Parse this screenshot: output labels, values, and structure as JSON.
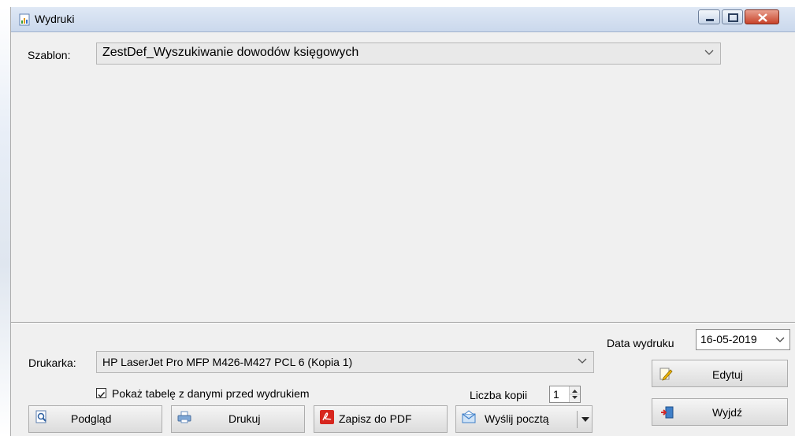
{
  "window": {
    "title": "Wydruki"
  },
  "template": {
    "label": "Szablon:",
    "value": "ZestDef_Wyszukiwanie dowodów księgowych"
  },
  "print_date": {
    "label": "Data wydruku",
    "value": "16-05-2019"
  },
  "printer": {
    "label": "Drukarka:",
    "value": "HP LaserJet Pro MFP M426-M427 PCL 6 (Kopia 1)"
  },
  "show_table": {
    "label": "Pokaż tabelę z danymi przed wydrukiem",
    "checked": true
  },
  "copies": {
    "label": "Liczba kopii",
    "value": "1"
  },
  "buttons": {
    "preview": "Podgląd",
    "print": "Drukuj",
    "save_pdf": "Zapisz do PDF",
    "send_mail": "Wyślij pocztą",
    "edit": "Edytuj",
    "exit": "Wyjdź"
  },
  "colors": {
    "window_bg": "#f0f0f0",
    "close_button": "#c8432a",
    "pdf_icon": "#d7261e"
  },
  "icons": {
    "title": "report-icon",
    "preview": "magnifier-document-icon",
    "print": "printer-icon",
    "save_pdf": "pdf-icon",
    "send_mail": "envelope-icon",
    "edit": "pencil-document-icon",
    "exit": "exit-door-icon"
  }
}
